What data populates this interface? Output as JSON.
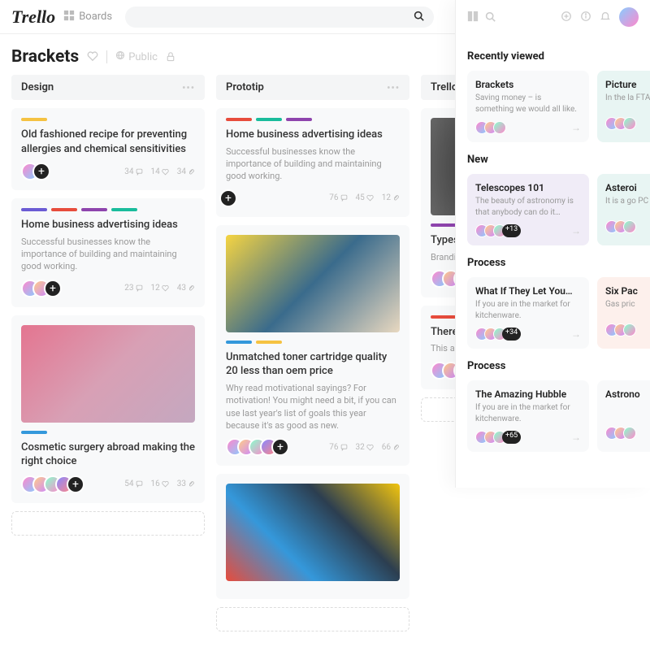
{
  "app": {
    "logo": "Trello",
    "boards_label": "Boards"
  },
  "board": {
    "title": "Brackets",
    "public_label": "Public"
  },
  "lists": [
    {
      "title": "Design",
      "cards": [
        {
          "labels": [
            "#f5c242"
          ],
          "title": "Old fashioned recipe for preventing allergies and chemical sensitivities",
          "desc": "",
          "stats": {
            "comments": 34,
            "likes": 14,
            "attachments": 34
          },
          "avatars": 1
        },
        {
          "labels": [
            "#6b5bd4",
            "#e74c3c",
            "#8e44ad",
            "#1abc9c"
          ],
          "title": "Home business advertising ideas",
          "desc": "Successful businesses know the importance of building and maintaining good working.",
          "stats": {
            "comments": 23,
            "likes": 12,
            "attachments": 43
          },
          "avatars": 2
        },
        {
          "image": "hand",
          "labels": [
            "#3498db"
          ],
          "title": "Cosmetic surgery abroad making the right choice",
          "desc": "",
          "stats": {
            "comments": 54,
            "likes": 16,
            "attachments": 33
          },
          "avatars": 4
        }
      ]
    },
    {
      "title": "Prototip",
      "cards": [
        {
          "labels": [
            "#e74c3c",
            "#1abc9c",
            "#8e44ad"
          ],
          "title": "Home business advertising ideas",
          "desc": "Successful businesses know the importance of building and maintaining good working.",
          "stats": {
            "comments": 76,
            "likes": 45,
            "attachments": 12
          },
          "avatars": 0,
          "plus_only": true
        },
        {
          "image": "popart",
          "labels": [
            "#3498db",
            "#f5c242"
          ],
          "title": "Unmatched toner cartridge quality 20 less than oem price",
          "desc": "Why read motivational sayings? For motivation! You might need a bit, if you can use last year's list of goals this year because it's as good as new.",
          "stats": {
            "comments": 76,
            "likes": 32,
            "attachments": 66
          },
          "avatars": 4
        },
        {
          "image": "abstract"
        }
      ]
    },
    {
      "title": "Trello",
      "cards": [
        {
          "image": "black",
          "labels": [
            "#8e44ad"
          ],
          "title": "Types of p",
          "desc": "Branding is appeal (or th as given in m",
          "avatars": 3
        },
        {
          "labels": [
            "#e74c3c",
            "#1abc9c"
          ],
          "title": "There is no",
          "desc": "This article i you find the b",
          "avatars": 2
        }
      ]
    }
  ],
  "panel": {
    "sections": [
      {
        "title": "Recently viewed",
        "items": [
          {
            "title": "Brackets",
            "desc": "Saving money – is something we would all like.",
            "avatars": 3,
            "tone": "plain"
          },
          {
            "title": "Picture",
            "desc": "In the la FTA sate",
            "avatars": 3,
            "tone": "teal"
          }
        ]
      },
      {
        "title": "New",
        "items": [
          {
            "title": "Telescopes 101",
            "desc": "The beauty of astronomy is that anybody can do it…",
            "avatars": 3,
            "count": "+13",
            "tone": "purple"
          },
          {
            "title": "Asteroi",
            "desc": "It is a go PC as an",
            "avatars": 3,
            "tone": "teal"
          }
        ]
      },
      {
        "title": "Process",
        "items": [
          {
            "title": "What If They Let You…",
            "desc": "If you are in the market for kitchenware.",
            "avatars": 3,
            "count": "+34",
            "tone": "plain"
          },
          {
            "title": "Six Pac",
            "desc": "Gas pric",
            "avatars": 3,
            "tone": "peach"
          }
        ]
      },
      {
        "title": "Process",
        "items": [
          {
            "title": "The Amazing Hubble",
            "desc": "If you are in the market for kitchenware.",
            "avatars": 3,
            "count": "+65",
            "tone": "plain"
          },
          {
            "title": "Astrono",
            "desc": "",
            "avatars": 3,
            "tone": "plain"
          }
        ]
      }
    ]
  }
}
